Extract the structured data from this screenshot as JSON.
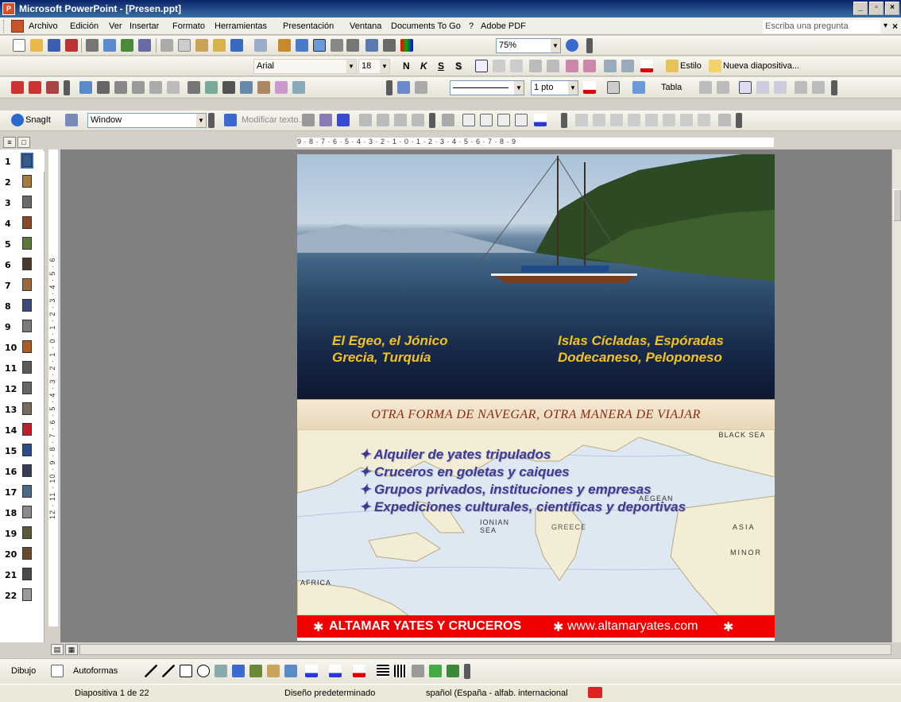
{
  "window": {
    "title": "Microsoft PowerPoint - [Presen.ppt]"
  },
  "menu": {
    "items": [
      "Archivo",
      "Edición",
      "Ver",
      "Insertar",
      "Formato",
      "Herramientas",
      "Presentación",
      "Ventana",
      "Documents To Go",
      "?",
      "Adobe PDF"
    ],
    "ask_placeholder": "Escriba una pregunta"
  },
  "standard_toolbar": {
    "zoom": "75%"
  },
  "format_toolbar": {
    "font": "Arial",
    "size": "18",
    "bold": "N",
    "italic": "K",
    "underline": "S",
    "shadow": "S",
    "style_label": "Estilo",
    "new_slide_label": "Nueva diapositiva..."
  },
  "tables_toolbar": {
    "line_weight": "1 pto",
    "tabla_label": "Tabla"
  },
  "snagit_toolbar": {
    "snagit_label": "SnagIt",
    "window_combo": "Window",
    "edit_text_label": "Modificar texto..."
  },
  "ruler": {
    "horizontal": "9 · 8 · 7 · 6 · 5 · 4 · 3 · 2 · 1 · 0 · 1 · 2 · 3 · 4 · 5 · 6 · 7 · 8 · 9",
    "vertical": "12 · 11 · 10 · 9 · 8 · 7 · 6 · 5 · 4 · 3 · 2 · 1 · 0 · 1 · 2 · 3 · 4 · 5 · 6"
  },
  "thumbnails": [
    "1",
    "2",
    "3",
    "4",
    "5",
    "6",
    "7",
    "8",
    "9",
    "10",
    "11",
    "12",
    "13",
    "14",
    "15",
    "16",
    "17",
    "18",
    "19",
    "20",
    "21",
    "22"
  ],
  "slide": {
    "left_line1": "El Egeo, el Jónico",
    "left_line2": "Grecia, Turquía",
    "right_line1": "Islas Cícladas, Espóradas",
    "right_line2": "Dodecaneso, Peloponeso",
    "tagline": "OTRA FORMA DE NAVEGAR, OTRA MANERA DE VIAJAR",
    "bullets": [
      "✦ Alquiler de yates tripulados",
      "✦ Cruceros en goletas y caiques",
      "✦ Grupos privados, instituciones y empresas",
      "✦ Expediciones culturales, científicas y deportivas"
    ],
    "map_labels": {
      "black_sea": "BLACK SEA",
      "ionian_sea": "IONIAN SEA",
      "africa": "AFRICA",
      "minor": "MINOR",
      "asia": "ASIA",
      "aegean": "AEGEAN",
      "greece": "GREECE"
    },
    "footer_brand": "ALTAMAR YATES Y CRUCEROS",
    "footer_url": "www.altamaryates.com",
    "footer_star": "✱"
  },
  "drawing_toolbar": {
    "draw_label": "Dibujo",
    "autoshapes_label": "Autoformas"
  },
  "status": {
    "slide_info": "Diapositiva 1 de 22",
    "design": "Diseño predeterminado",
    "language": "spañol (España - alfab. internacional"
  },
  "colors": {
    "title_bar": "#0a246a",
    "photo_text": "#f4c21c",
    "tagline": "#8b2a12",
    "bullets": "#3b3a98",
    "footer_bg": "#f00000"
  }
}
